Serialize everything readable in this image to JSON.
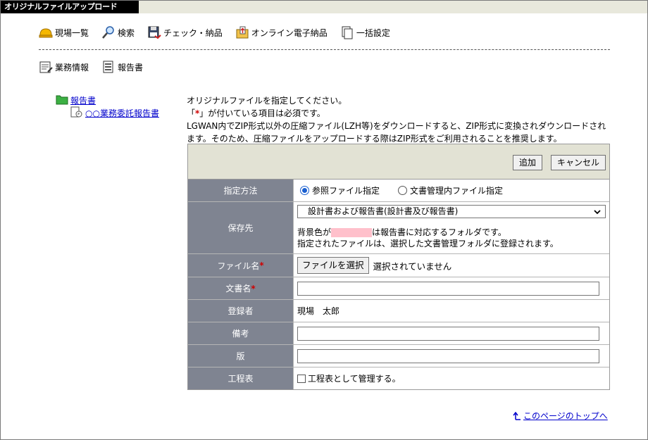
{
  "window": {
    "title": "オリジナルファイルアップロード"
  },
  "toolbar": {
    "items": [
      {
        "label": "現場一覧",
        "icon": "helmet-icon"
      },
      {
        "label": "検索",
        "icon": "magnifier-icon"
      },
      {
        "label": "チェック・納品",
        "icon": "floppy-check-icon"
      },
      {
        "label": "オンライン電子納品",
        "icon": "upload-folder-icon"
      },
      {
        "label": "一括設定",
        "icon": "documents-icon"
      }
    ]
  },
  "toolbar2": {
    "items": [
      {
        "label": "業務情報",
        "icon": "notepad-icon"
      },
      {
        "label": "報告書",
        "icon": "report-icon"
      }
    ]
  },
  "tree": {
    "root": "報告書",
    "child": "○○業務委託報告書"
  },
  "info": {
    "line1": "オリジナルファイルを指定してください。",
    "line2_pre": "「",
    "line2_star": "*",
    "line2_post": "」が付いている項目は必須です。",
    "line3": "LGWAN内でZIP形式以外の圧縮ファイル(LZH等)をダウンロードすると、ZIP形式に変換されダウンロードされます。そのため、圧縮ファイルをアップロードする際はZIP形式をご利用されることを推奨します。"
  },
  "form": {
    "add_label": "追加",
    "cancel_label": "キャンセル",
    "method": {
      "label": "指定方法",
      "opt1": "参照ファイル指定",
      "opt2": "文書管理内ファイル指定"
    },
    "dest": {
      "label": "保存先",
      "selected": "設計書および報告書(設計書及び報告書)",
      "note1_pre": "背景色が",
      "note1_post": "は報告書に対応するフォルダです。",
      "note2": "指定されたファイルは、選択した文書管理フォルダに登録されます。"
    },
    "file": {
      "label": "ファイル名",
      "button": "ファイルを選択",
      "status": "選択されていません"
    },
    "docname": {
      "label": "文書名",
      "value": ""
    },
    "registrant": {
      "label": "登録者",
      "value": "現場　太郎"
    },
    "remarks": {
      "label": "備考",
      "value": ""
    },
    "version": {
      "label": "版",
      "value": ""
    },
    "schedule": {
      "label": "工程表",
      "checkbox_label": "工程表として管理する。"
    },
    "required_mark": "*"
  },
  "footer": {
    "top_link": "このページのトップへ"
  },
  "colors": {
    "label_bg": "#7f8491",
    "header_bg": "#e2e2d4",
    "link": "#0000cc",
    "required": "#d00000",
    "highlight": "#ffc0cb"
  }
}
